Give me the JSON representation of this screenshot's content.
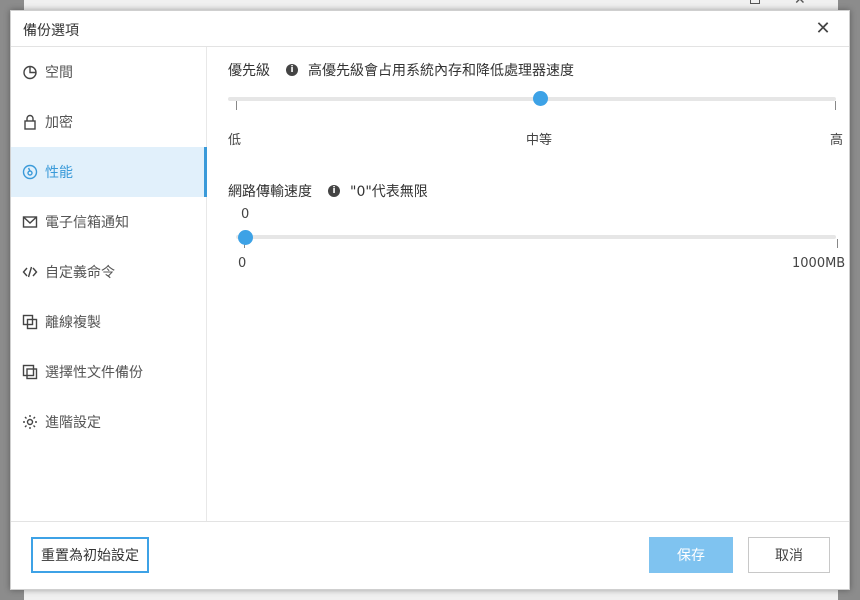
{
  "dialog": {
    "title": "備份選項",
    "close_symbol": "✕"
  },
  "sidebar": {
    "items": [
      {
        "label": "空間",
        "icon": "pie-chart-icon",
        "active": false
      },
      {
        "label": "加密",
        "icon": "lock-icon",
        "active": false
      },
      {
        "label": "性能",
        "icon": "gauge-icon",
        "active": true
      },
      {
        "label": "電子信箱通知",
        "icon": "mail-icon",
        "active": false
      },
      {
        "label": "自定義命令",
        "icon": "code-icon",
        "active": false
      },
      {
        "label": "離線複製",
        "icon": "copy-icon",
        "active": false
      },
      {
        "label": "選擇性文件備份",
        "icon": "file-select-icon",
        "active": false
      },
      {
        "label": "進階設定",
        "icon": "gear-icon",
        "active": false
      }
    ]
  },
  "priority": {
    "label": "優先級",
    "hint": "高優先級會占用系統內存和降低處理器速度",
    "ticks": [
      "低",
      "中等",
      "高"
    ],
    "selected_index": 1
  },
  "network": {
    "label": "網路傳輸速度",
    "hint": "\"0\"代表無限",
    "current_value": "0",
    "min_label": "0",
    "max_label": "1000MB",
    "value_fraction": 0
  },
  "footer": {
    "reset_label": "重置為初始設定",
    "save_label": "保存",
    "cancel_label": "取消"
  },
  "colors": {
    "accent": "#3da2e6",
    "active_bg": "#e1f0fb",
    "save_bg": "#7fc3f0"
  }
}
